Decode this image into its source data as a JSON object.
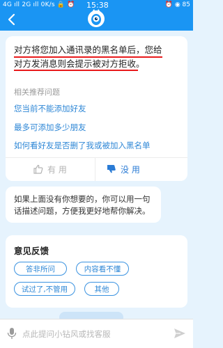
{
  "status_bar": {
    "left": "4G ıll 2G ıll 0K/s 🔒 ⏰",
    "time": "15:38",
    "right": "⏰ ◉ 85"
  },
  "header": {
    "back_icon": "chevron-left-icon",
    "mascot_icon": "assistant-mascot-icon"
  },
  "answer": {
    "text": "对方将您加入通讯录的黑名单后，您给对方发消息则会提示被对方拒收。",
    "related_title": "相关推荐问题",
    "related_questions": [
      "您当前不能添加好友",
      "最多可添加多少朋友",
      "如何看好友是否删了我或被加入黑名单"
    ],
    "helpful_label": "有 用",
    "unhelpful_label": "没 用"
  },
  "fallback": {
    "text": "如果上面没有你想要的，你可以用一句话描述问题，方便我更好地帮你解决。"
  },
  "feedback": {
    "title": "意见反馈",
    "options": [
      "答非所问",
      "内容看不懂",
      "试过了,不管用",
      "其他"
    ]
  },
  "input": {
    "placeholder": "点此提问小钻风或找客服"
  },
  "colors": {
    "header": "#1a95f3",
    "background": "#e6f3fd",
    "link": "#2e87d6",
    "underline": "#e8191b"
  }
}
